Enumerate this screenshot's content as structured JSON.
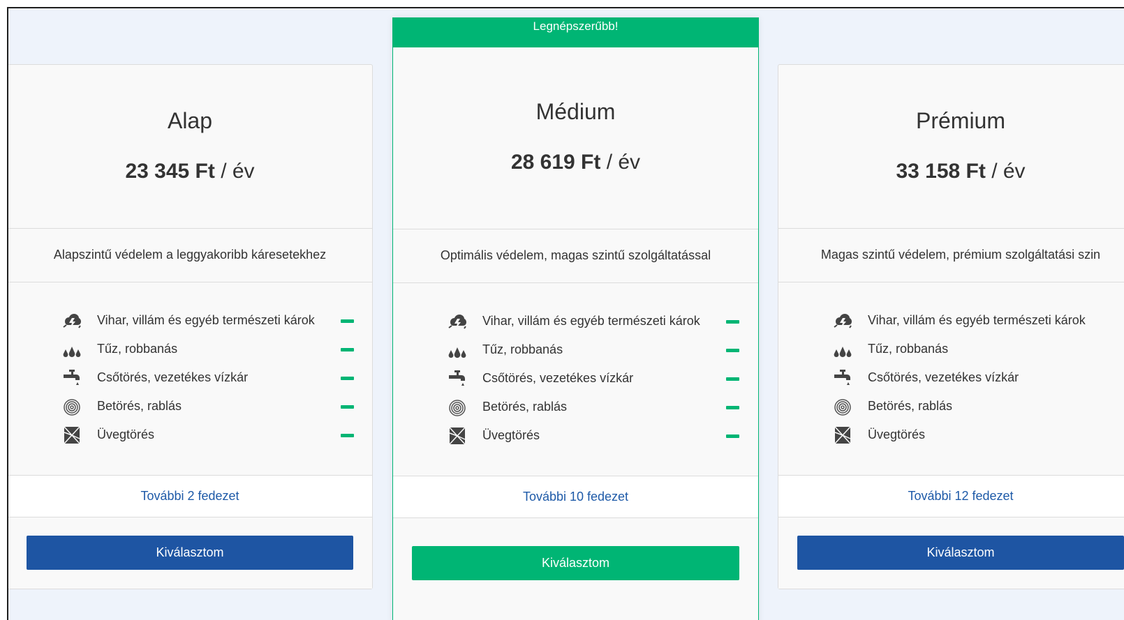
{
  "ribbon": "Legnépszerűbb!",
  "feature_icons": [
    "storm-icon",
    "fire-drops-icon",
    "faucet-icon",
    "fingerprint-icon",
    "broken-glass-icon"
  ],
  "colors": {
    "green": "#00b574",
    "blue": "#1e55a3",
    "link": "#1e5aa8"
  },
  "plans": [
    {
      "name": "Alap",
      "price": "23 345 Ft",
      "period": " / év",
      "description": "Alapszintű védelem a leggyakoribb káresetekhez",
      "features": [
        "Vihar, villám és egyéb természeti károk",
        "Tűz, robbanás",
        "Csőtörés, vezetékes vízkár",
        "Betörés, rablás",
        "Üvegtörés"
      ],
      "more": "További 2 fedezet",
      "button": "Kiválasztom"
    },
    {
      "name": "Médium",
      "price": "28 619 Ft",
      "period": " / év",
      "description": "Optimális védelem, magas szintű szolgáltatással",
      "features": [
        "Vihar, villám és egyéb természeti károk",
        "Tűz, robbanás",
        "Csőtörés, vezetékes vízkár",
        "Betörés, rablás",
        "Üvegtörés"
      ],
      "more": "További 10 fedezet",
      "button": "Kiválasztom"
    },
    {
      "name": "Prémium",
      "price": "33 158 Ft",
      "period": " / év",
      "description": "Magas szintű védelem, prémium szolgáltatási szin",
      "features": [
        "Vihar, villám és egyéb természeti károk",
        "Tűz, robbanás",
        "Csőtörés, vezetékes vízkár",
        "Betörés, rablás",
        "Üvegtörés"
      ],
      "more": "További 12 fedezet",
      "button": "Kiválasztom"
    }
  ]
}
